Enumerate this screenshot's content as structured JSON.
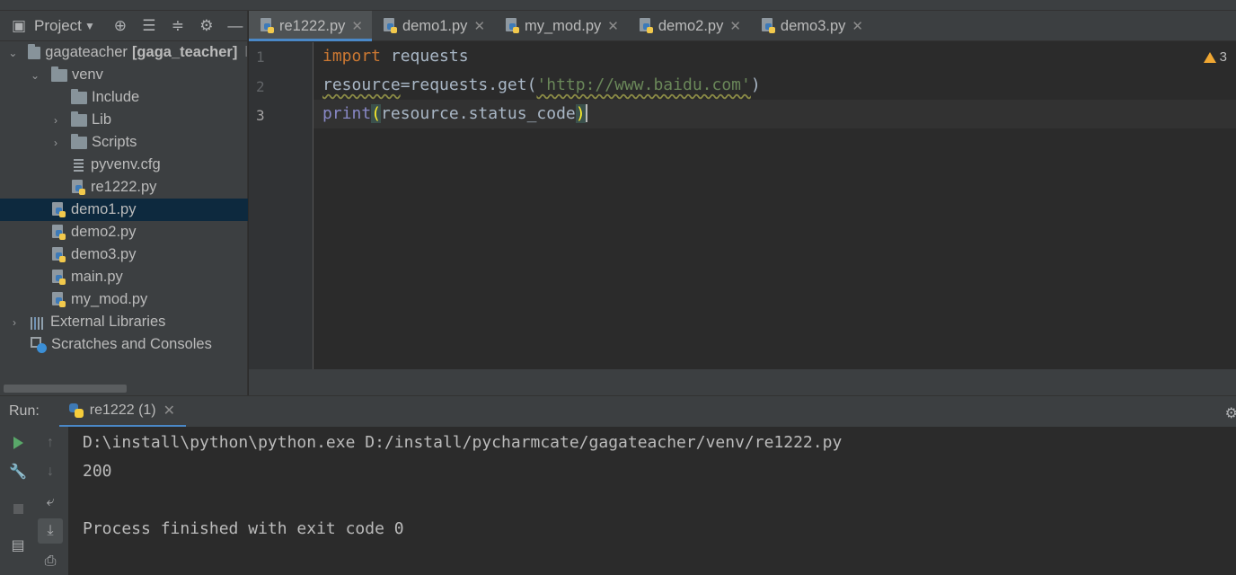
{
  "project_panel": {
    "title": "Project",
    "tree": [
      {
        "label": "gagateacher",
        "bold": "[gaga_teacher]",
        "trail": "l"
      },
      {
        "label": "venv"
      },
      {
        "label": "Include"
      },
      {
        "label": "Lib"
      },
      {
        "label": "Scripts"
      },
      {
        "label": "pyvenv.cfg"
      },
      {
        "label": "re1222.py"
      },
      {
        "label": "demo1.py"
      },
      {
        "label": "demo2.py"
      },
      {
        "label": "demo3.py"
      },
      {
        "label": "main.py"
      },
      {
        "label": "my_mod.py"
      },
      {
        "label": "External Libraries"
      },
      {
        "label": "Scratches and Consoles"
      }
    ],
    "selected": "demo1.py"
  },
  "tabs": [
    {
      "label": "re1222.py",
      "active": true
    },
    {
      "label": "demo1.py"
    },
    {
      "label": "my_mod.py"
    },
    {
      "label": "demo2.py"
    },
    {
      "label": "demo3.py"
    }
  ],
  "editor": {
    "line_numbers": [
      "1",
      "2",
      "3"
    ],
    "current_line": "3",
    "warning_count": "3",
    "code": {
      "l1_kw": "import",
      "l1_rest": " requests",
      "l2_a": "resource",
      "l2_b": "=requests.get(",
      "l2_str": "'http://www.baidu.com'",
      "l2_c": ")",
      "l3_fn": "print",
      "l3_open": "(",
      "l3_mid": "resource.status_code",
      "l3_close": ")"
    }
  },
  "run": {
    "label": "Run:",
    "tab": "re1222 (1)",
    "console": [
      "D:\\install\\python\\python.exe D:/install/pycharmcate/gagateacher/venv/re1222.py",
      "200",
      "",
      "Process finished with exit code 0"
    ]
  },
  "colors": {
    "accent": "#4a88c7",
    "selection": "#0d293e",
    "keyword": "#cc7832",
    "string": "#6a8759",
    "builtin": "#8888c6"
  }
}
